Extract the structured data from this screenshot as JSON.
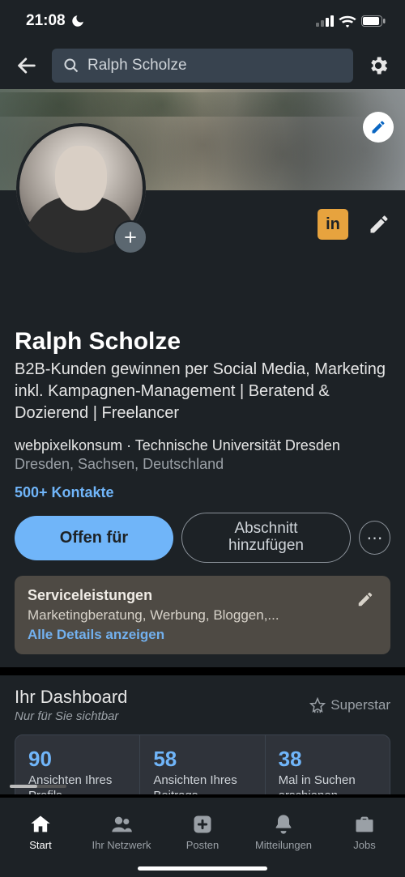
{
  "status": {
    "time": "21:08"
  },
  "search": {
    "value": "Ralph Scholze"
  },
  "cover": {
    "edit_icon": "pencil-icon"
  },
  "profile": {
    "name": "Ralph Scholze",
    "headline": "B2B-Kunden gewinnen per Social Media, Marketing inkl. Kampagnen-Management |  Beratend & Dozierend | Freelancer",
    "company_edu": "webpixelkonsum · Technische Universität Dresden",
    "location": "Dresden, Sachsen, Deutschland",
    "connections": "500+ Kontakte",
    "linkedin_badge": "in"
  },
  "actions": {
    "primary": "Offen für",
    "secondary": "Abschnitt hinzufügen",
    "more": "⋯"
  },
  "services_card": {
    "title": "Serviceleistungen",
    "description": "Marketingberatung, Werbung, Bloggen,...",
    "link": "Alle Details anzeigen"
  },
  "dashboard": {
    "title": "Ihr Dashboard",
    "subtitle": "Nur für Sie sichtbar",
    "badge": "Superstar",
    "stats": [
      {
        "value": "90",
        "label": "Ansichten Ihres Profils"
      },
      {
        "value": "58",
        "label": "Ansichten Ihres Beitrags"
      },
      {
        "value": "38",
        "label": "Mal in Suchen erschienen"
      }
    ]
  },
  "tabs": {
    "start": "Start",
    "network": "Ihr Netzwerk",
    "post": "Posten",
    "notifications": "Mitteilungen",
    "jobs": "Jobs"
  }
}
